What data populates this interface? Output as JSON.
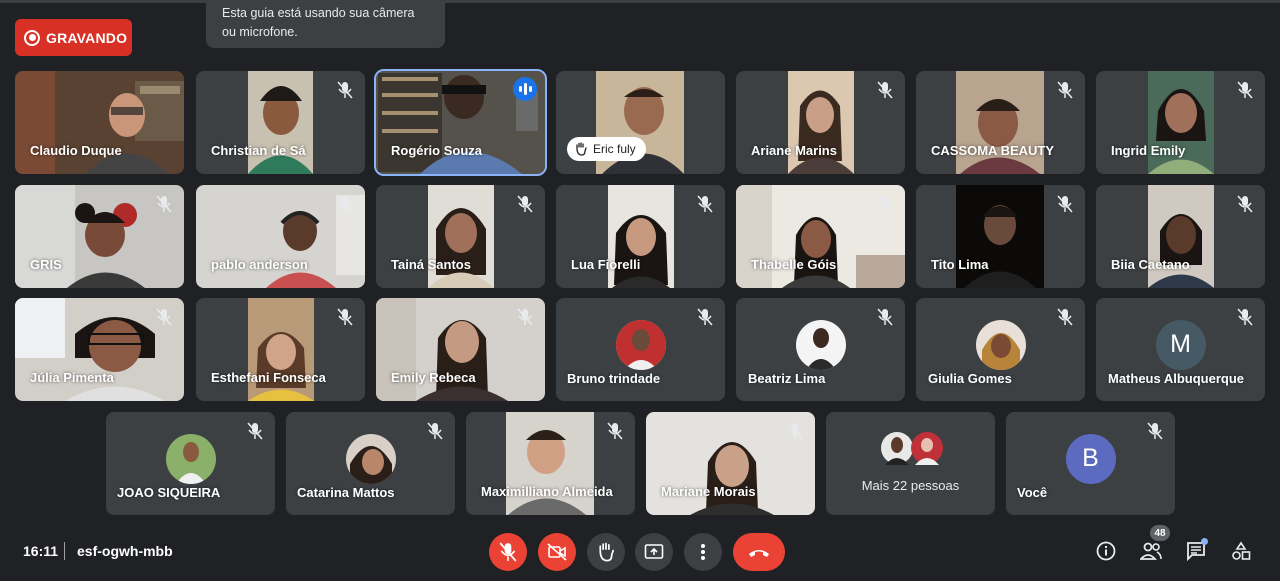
{
  "recording": {
    "label": "GRAVANDO",
    "color": "#d93025"
  },
  "toast": {
    "text": "Esta guia está usando sua câmera ou microfone."
  },
  "participants": [
    {
      "name": "Claudio Duque",
      "muted": false
    },
    {
      "name": "Christian de Sá",
      "muted": true
    },
    {
      "name": "Rogério Souza",
      "muted": false,
      "speaking": true
    },
    {
      "name": "Eric fuly",
      "muted": false,
      "hand_raised": true
    },
    {
      "name": "Ariane Marins",
      "muted": true
    },
    {
      "name": "CASSOMA BEAUTY",
      "muted": true
    },
    {
      "name": "Ingrid Emily",
      "muted": true
    },
    {
      "name": "GRIS",
      "muted": true
    },
    {
      "name": "pablo anderson",
      "muted": true
    },
    {
      "name": "Tainá Santos",
      "muted": true
    },
    {
      "name": "Lua Fiorelli",
      "muted": true
    },
    {
      "name": "Thabelle Góis",
      "muted": true
    },
    {
      "name": "Tito Lima",
      "muted": true
    },
    {
      "name": "Biia Caetano",
      "muted": true
    },
    {
      "name": "Júlia Pimenta",
      "muted": true
    },
    {
      "name": "Esthefani Fonseca",
      "muted": true
    },
    {
      "name": "Emily Rebeca",
      "muted": true
    },
    {
      "name": "Bruno trindade",
      "muted": true
    },
    {
      "name": "Beatriz Lima",
      "muted": true
    },
    {
      "name": "Giulia Gomes",
      "muted": true
    },
    {
      "name": "Matheus Albuquerque",
      "muted": true,
      "avatar_letter": "M",
      "avatar_color": "#455a64"
    },
    {
      "name": "JOAO SIQUEIRA",
      "muted": true
    },
    {
      "name": "Catarina Mattos",
      "muted": true
    },
    {
      "name": "Maximilliano Almeida",
      "muted": true
    },
    {
      "name": "Mariane Morais",
      "muted": true
    },
    {
      "name": "Mais 22 pessoas",
      "muted": false
    },
    {
      "name": "Você",
      "muted": true,
      "avatar_letter": "B",
      "avatar_color": "#5c6bc0"
    }
  ],
  "hand_chip": {
    "label": "Eric fuly"
  },
  "footer": {
    "time": "16:11",
    "meeting_code": "esf-ogwh-mbb",
    "participants_count": "48"
  },
  "controls": [
    {
      "icon": "mic-off-icon",
      "state": "off"
    },
    {
      "icon": "camera-off-icon",
      "state": "off"
    },
    {
      "icon": "raise-hand-icon"
    },
    {
      "icon": "present-screen-icon"
    },
    {
      "icon": "more-options-icon"
    },
    {
      "icon": "leave-call-icon"
    }
  ],
  "right_icons": [
    "info-icon",
    "people-icon",
    "chat-icon",
    "activities-icon"
  ],
  "colors": {
    "background": "#202124",
    "tile": "#3c4043",
    "danger": "#ea4335",
    "accent": "#1a73e8"
  }
}
